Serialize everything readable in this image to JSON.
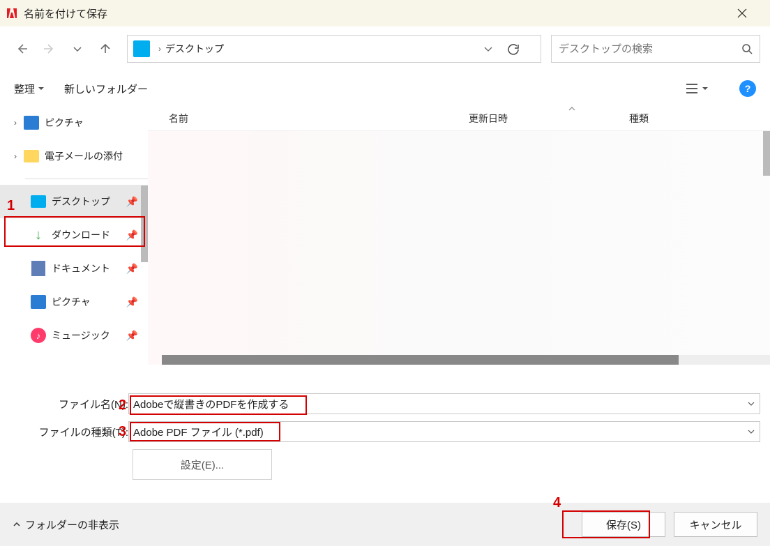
{
  "window": {
    "title": "名前を付けて保存"
  },
  "breadcrumb": {
    "location": "デスクトップ"
  },
  "search": {
    "placeholder": "デスクトップの検索"
  },
  "toolbar": {
    "organize": "整理",
    "newfolder": "新しいフォルダー"
  },
  "tree": {
    "pictures": "ピクチャ",
    "email": "電子メールの添付",
    "desktop": "デスクトップ",
    "downloads": "ダウンロード",
    "documents": "ドキュメント",
    "pictures2": "ピクチャ",
    "music": "ミュージック"
  },
  "columns": {
    "name": "名前",
    "date": "更新日時",
    "type": "種類"
  },
  "form": {
    "filename_label": "ファイル名(N):",
    "filename_value": "Adobeで縦書きのPDFを作成する",
    "filetype_label": "ファイルの種類(T):",
    "filetype_value": "Adobe PDF ファイル (*.pdf)",
    "settings": "設定(E)..."
  },
  "footer": {
    "hidefolders": "フォルダーの非表示",
    "save": "保存(S)",
    "cancel": "キャンセル"
  },
  "annotations": {
    "n1": "1",
    "n2": "2",
    "n3": "3",
    "n4": "4"
  }
}
